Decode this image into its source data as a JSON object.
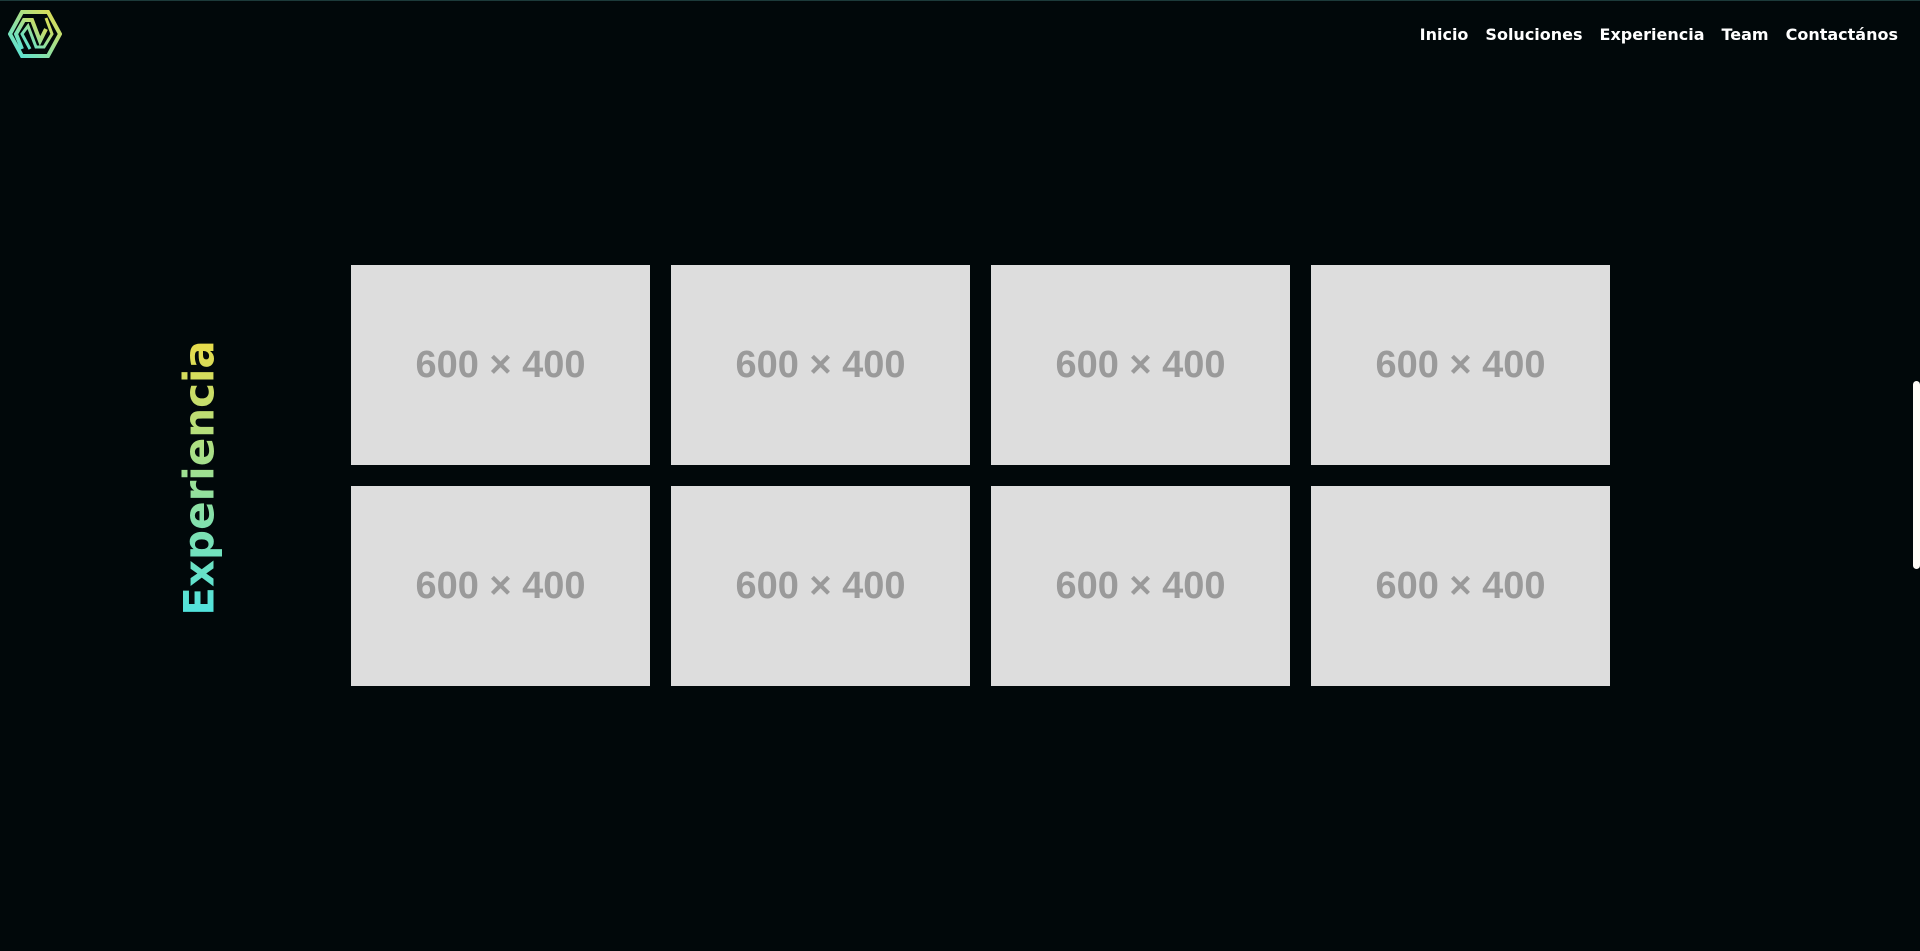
{
  "header": {
    "logo": "brand-logo",
    "nav": [
      "Inicio",
      "Soluciones",
      "Experiencia",
      "Team",
      "Contactános"
    ]
  },
  "section": {
    "title": "Experiencia",
    "gradient": [
      "#4fe3df",
      "#e8dc4a"
    ],
    "images": [
      "600 × 400",
      "600 × 400",
      "600 × 400",
      "600 × 400",
      "600 × 400",
      "600 × 400",
      "600 × 400",
      "600 × 400"
    ]
  },
  "colors": {
    "background": "#01080a",
    "placeholder": "#dddddd",
    "placeholder_text": "#9a9a9a"
  }
}
